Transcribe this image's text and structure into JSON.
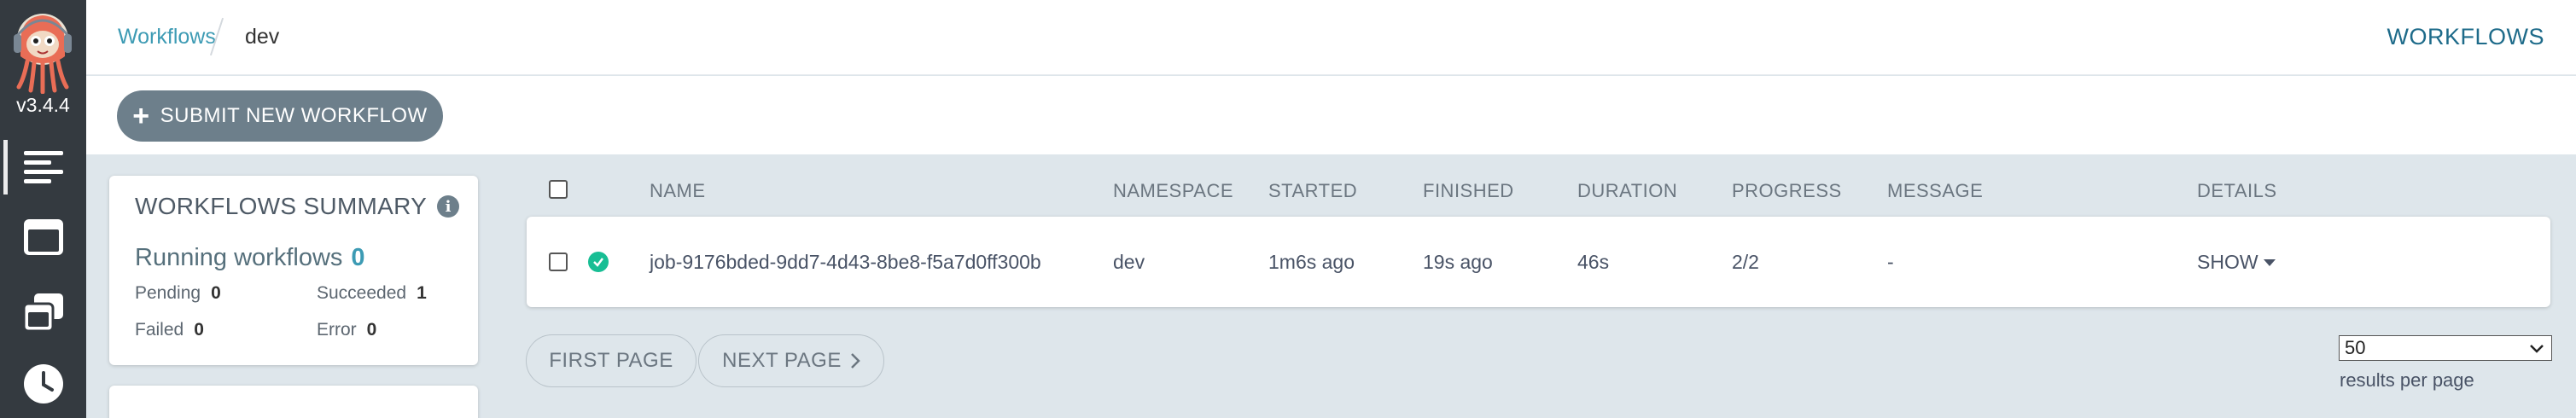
{
  "app": {
    "version": "v3.4.4"
  },
  "nav": {
    "items": [
      {
        "icon": "workflows-icon",
        "active": true
      },
      {
        "icon": "workflow-templates-icon",
        "active": false
      },
      {
        "icon": "cluster-templates-icon",
        "active": false
      },
      {
        "icon": "cron-workflows-icon",
        "active": false
      }
    ]
  },
  "breadcrumb": {
    "link": "Workflows",
    "current": "dev"
  },
  "header": {
    "title": "WORKFLOWS"
  },
  "actions": {
    "submit_label": "SUBMIT NEW WORKFLOW"
  },
  "summary": {
    "title": "WORKFLOWS SUMMARY",
    "running_label": "Running workflows",
    "running_count": "0",
    "pending_label": "Pending",
    "pending_count": "0",
    "succeeded_label": "Succeeded",
    "succeeded_count": "1",
    "failed_label": "Failed",
    "failed_count": "0",
    "error_label": "Error",
    "error_count": "0"
  },
  "table": {
    "columns": {
      "name": "NAME",
      "namespace": "NAMESPACE",
      "started": "STARTED",
      "finished": "FINISHED",
      "duration": "DURATION",
      "progress": "PROGRESS",
      "message": "MESSAGE",
      "details": "DETAILS"
    },
    "rows": [
      {
        "status": "succeeded",
        "name": "job-9176bded-9dd7-4d43-8be8-f5a7d0ff300b",
        "namespace": "dev",
        "started": "1m6s ago",
        "finished": "19s ago",
        "duration": "46s",
        "progress": "2/2",
        "message": "-",
        "details": "SHOW"
      }
    ]
  },
  "pagination": {
    "first_label": "FIRST PAGE",
    "next_label": "NEXT PAGE",
    "per_page_value": "50",
    "per_page_label": "results per page"
  },
  "colors": {
    "nav_bg": "#343a40",
    "accent": "#3d9bb4",
    "success": "#18be94",
    "page_bg": "#dee6eb"
  }
}
